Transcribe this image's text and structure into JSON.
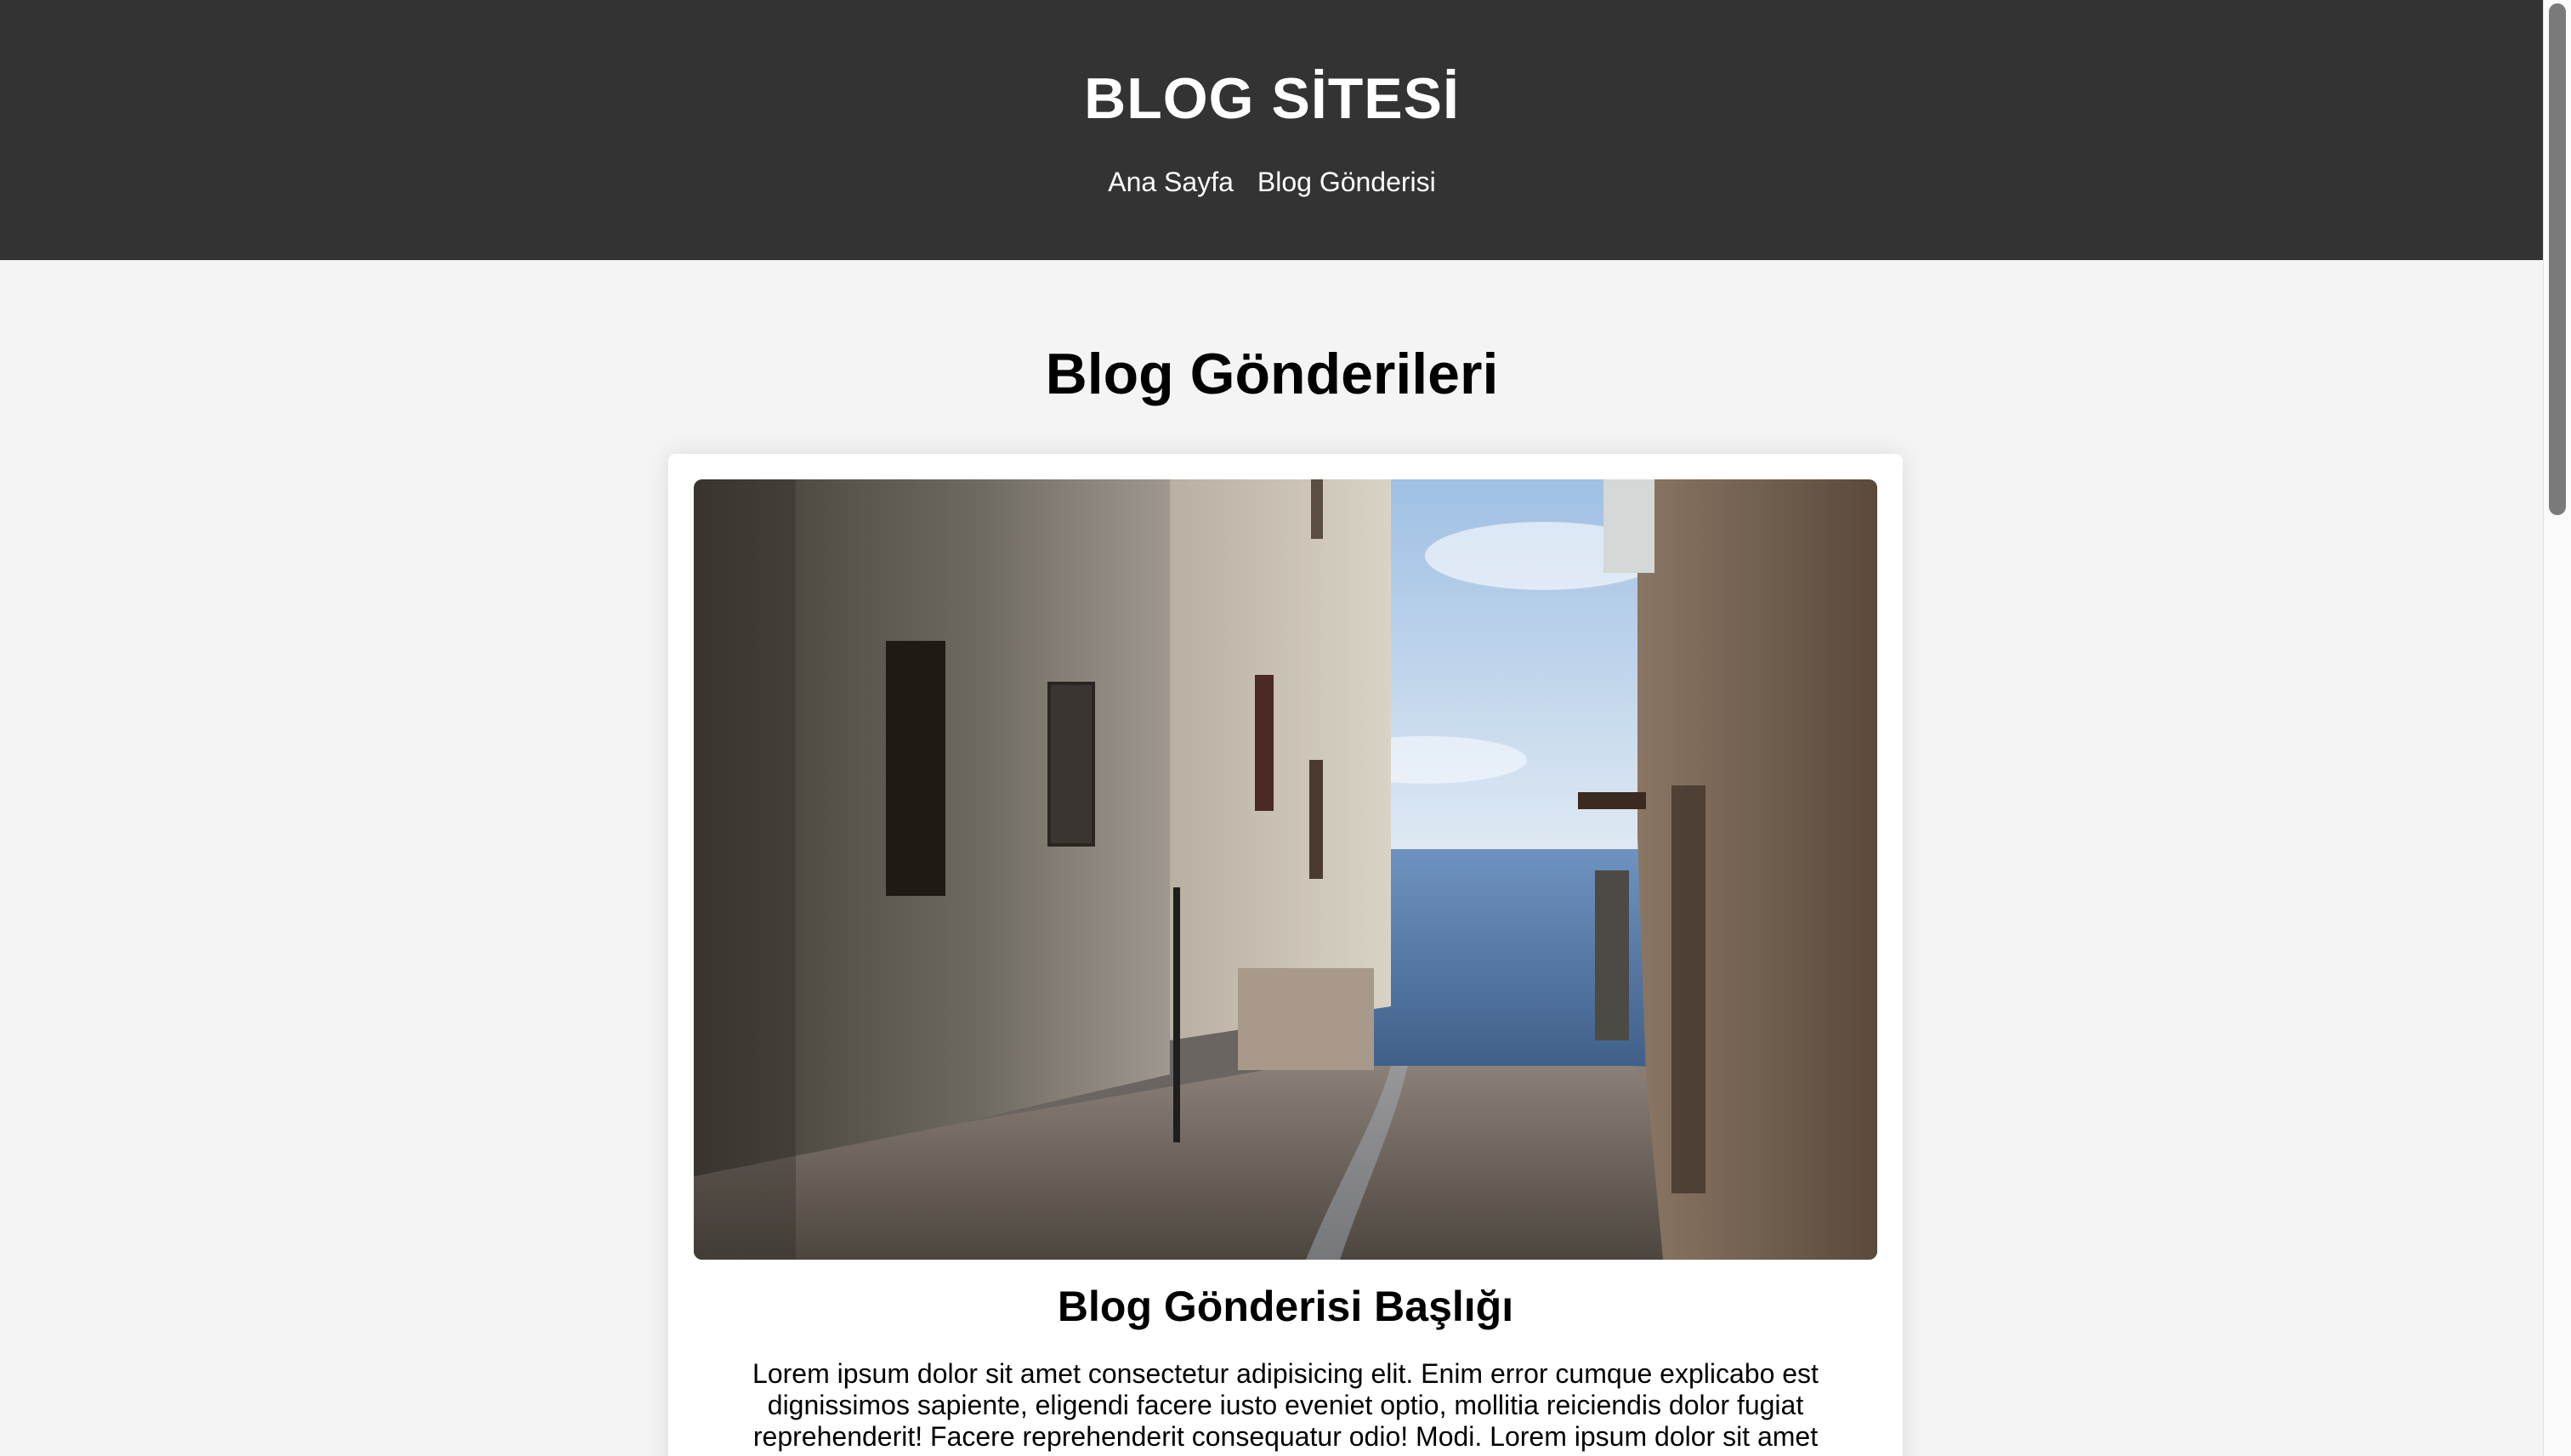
{
  "header": {
    "site_title": "BLOG SİTESİ",
    "nav": [
      "Ana Sayfa",
      "Blog Gönderisi"
    ]
  },
  "main": {
    "section_title": "Blog Gönderileri",
    "post": {
      "image_alt": "alley-to-sea-photo",
      "title": "Blog Gönderisi Başlığı",
      "excerpt": "Lorem ipsum dolor sit amet consectetur adipisicing elit. Enim error cumque explicabo est dignissimos sapiente, eligendi facere iusto eveniet optio, mollitia reiciendis dolor fugiat reprehenderit! Facere reprehenderit consequatur odio! Modi. Lorem ipsum dolor sit amet"
    }
  },
  "colors": {
    "header_bg": "#333333",
    "page_bg": "#f4f4f4",
    "card_bg": "#ffffff"
  }
}
